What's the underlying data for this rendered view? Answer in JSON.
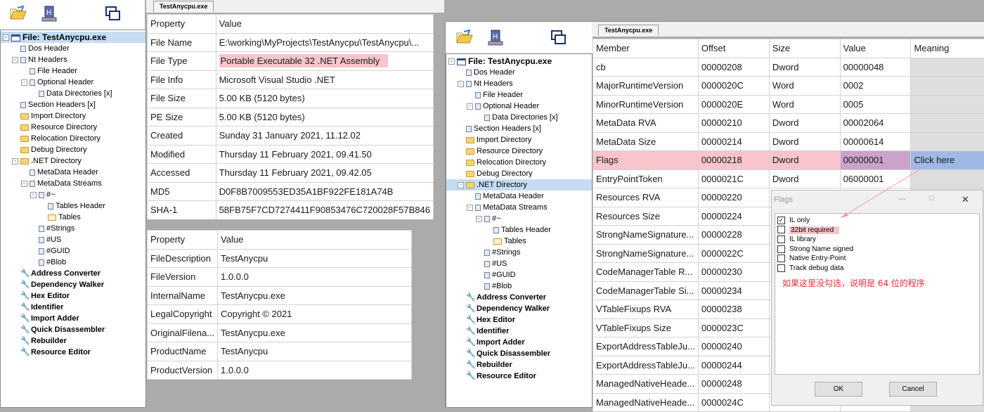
{
  "left_toolbar": {
    "icons": [
      "open-folder-icon",
      "build-icon",
      "windows-icon"
    ]
  },
  "left_tree": {
    "items": [
      {
        "label": "File: TestAnycpu.exe",
        "level": 0,
        "icon": "window",
        "exp": "-",
        "kind": "root",
        "sel": true
      },
      {
        "label": "Dos Header",
        "level": 1,
        "icon": "page"
      },
      {
        "label": "Nt Headers",
        "level": 1,
        "icon": "page",
        "exp": "-"
      },
      {
        "label": "File Header",
        "level": 2,
        "icon": "page"
      },
      {
        "label": "Optional Header",
        "level": 2,
        "icon": "page",
        "exp": "-"
      },
      {
        "label": "Data Directories [x]",
        "level": 3,
        "icon": "page"
      },
      {
        "label": "Section Headers [x]",
        "level": 1,
        "icon": "page"
      },
      {
        "label": "Import Directory",
        "level": 1,
        "icon": "folder"
      },
      {
        "label": "Resource Directory",
        "level": 1,
        "icon": "folder"
      },
      {
        "label": "Relocation Directory",
        "level": 1,
        "icon": "folder"
      },
      {
        "label": "Debug Directory",
        "level": 1,
        "icon": "folder"
      },
      {
        "label": ".NET Directory",
        "level": 1,
        "icon": "folder",
        "exp": "-"
      },
      {
        "label": "MetaData Header",
        "level": 2,
        "icon": "page"
      },
      {
        "label": "MetaData Streams",
        "level": 2,
        "icon": "page",
        "exp": "-"
      },
      {
        "label": "#~",
        "level": 3,
        "icon": "page",
        "exp": "-"
      },
      {
        "label": "Tables Header",
        "level": 4,
        "icon": "page"
      },
      {
        "label": "Tables",
        "level": 4,
        "icon": "folder-open"
      },
      {
        "label": "#Strings",
        "level": 3,
        "icon": "page"
      },
      {
        "label": "#US",
        "level": 3,
        "icon": "page"
      },
      {
        "label": "#GUID",
        "level": 3,
        "icon": "page"
      },
      {
        "label": "#Blob",
        "level": 3,
        "icon": "page"
      },
      {
        "label": "Address Converter",
        "level": 1,
        "icon": "tool",
        "kind": "bold"
      },
      {
        "label": "Dependency Walker",
        "level": 1,
        "icon": "tool",
        "kind": "bold"
      },
      {
        "label": "Hex Editor",
        "level": 1,
        "icon": "tool",
        "kind": "bold"
      },
      {
        "label": "Identifier",
        "level": 1,
        "icon": "tool",
        "kind": "bold"
      },
      {
        "label": "Import Adder",
        "level": 1,
        "icon": "tool",
        "kind": "bold"
      },
      {
        "label": "Quick Disassembler",
        "level": 1,
        "icon": "tool",
        "kind": "bold"
      },
      {
        "label": "Rebuilder",
        "level": 1,
        "icon": "tool",
        "kind": "bold"
      },
      {
        "label": "Resource Editor",
        "level": 1,
        "icon": "tool",
        "kind": "bold"
      }
    ]
  },
  "left_tab": {
    "label": "TestAnycpu.exe"
  },
  "file_info_table": {
    "headers": [
      "Property",
      "Value"
    ],
    "rows": [
      [
        "File Name",
        "E:\\working\\MyProjects\\TestAnycpu\\TestAnycpu\\..."
      ],
      [
        "File Type",
        "Portable Executable 32 .NET Assembly"
      ],
      [
        "File Info",
        "Microsoft Visual Studio .NET"
      ],
      [
        "File Size",
        "5.00 KB (5120 bytes)"
      ],
      [
        "PE Size",
        "5.00 KB (5120 bytes)"
      ],
      [
        "Created",
        "Sunday 31 January 2021, 11.12.02"
      ],
      [
        "Modified",
        "Thursday 11 February 2021, 09.41.50"
      ],
      [
        "Accessed",
        "Thursday 11 February 2021, 09.42.05"
      ],
      [
        "MD5",
        "D0F8B7009553ED35A1BF922FE181A74B"
      ],
      [
        "SHA-1",
        "58FB75F7CD7274411F90853476C720028F57B846"
      ]
    ]
  },
  "version_table": {
    "headers": [
      "Property",
      "Value"
    ],
    "rows": [
      [
        "FileDescription",
        "TestAnycpu"
      ],
      [
        "FileVersion",
        "1.0.0.0"
      ],
      [
        "InternalName",
        "TestAnycpu.exe"
      ],
      [
        "LegalCopyright",
        "Copyright ©  2021"
      ],
      [
        "OriginalFilena...",
        "TestAnycpu.exe"
      ],
      [
        "ProductName",
        "TestAnycpu"
      ],
      [
        "ProductVersion",
        "1.0.0.0"
      ]
    ]
  },
  "right_tab": {
    "label": "TestAnycpu.exe"
  },
  "clr_table": {
    "headers": [
      "Member",
      "Offset",
      "Size",
      "Value",
      "Meaning"
    ],
    "rows": [
      [
        "cb",
        "00000208",
        "Dword",
        "00000048",
        ""
      ],
      [
        "MajorRuntimeVersion",
        "0000020C",
        "Word",
        "0002",
        ""
      ],
      [
        "MinorRuntimeVersion",
        "0000020E",
        "Word",
        "0005",
        ""
      ],
      [
        "MetaData RVA",
        "00000210",
        "Dword",
        "00002064",
        ""
      ],
      [
        "MetaData Size",
        "00000214",
        "Dword",
        "00000614",
        ""
      ],
      [
        "Flags",
        "00000218",
        "Dword",
        "00000001",
        "Click here"
      ],
      [
        "EntryPointToken",
        "0000021C",
        "Dword",
        "06000001",
        ""
      ],
      [
        "Resources RVA",
        "00000220",
        "",
        "",
        ""
      ],
      [
        "Resources Size",
        "00000224",
        "",
        "",
        ""
      ],
      [
        "StrongNameSignature...",
        "00000228",
        "",
        "",
        ""
      ],
      [
        "StrongNameSignature...",
        "0000022C",
        "",
        "",
        ""
      ],
      [
        "CodeManagerTable R...",
        "00000230",
        "",
        "",
        ""
      ],
      [
        "CodeManagerTable Si...",
        "00000234",
        "",
        "",
        ""
      ],
      [
        "VTableFixups RVA",
        "00000238",
        "",
        "",
        ""
      ],
      [
        "VTableFixups Size",
        "0000023C",
        "",
        "",
        ""
      ],
      [
        "ExportAddressTableJu...",
        "00000240",
        "",
        "",
        ""
      ],
      [
        "ExportAddressTableJu...",
        "00000244",
        "",
        "",
        ""
      ],
      [
        "ManagedNativeHeade...",
        "00000248",
        "",
        "",
        ""
      ],
      [
        "ManagedNativeHeade...",
        "0000024C",
        "",
        "",
        ""
      ]
    ]
  },
  "flags_dialog": {
    "title": "Flags",
    "options": [
      {
        "label": "IL only",
        "checked": true
      },
      {
        "label": "32bit required",
        "checked": false
      },
      {
        "label": "IL library",
        "checked": false
      },
      {
        "label": "Strong Name signed",
        "checked": false
      },
      {
        "label": "Native Entry-Point",
        "checked": false
      },
      {
        "label": "Track debug data",
        "checked": false
      }
    ],
    "note": "如果这里没勾选，说明是 64 位的程序",
    "ok_label": "OK",
    "cancel_label": "Cancel",
    "check_mark": "✓",
    "minimize_glyph": "—",
    "maximize_glyph": "□",
    "close_glyph": "✕"
  },
  "colors": {
    "highlight_red": "#f7c5cb",
    "highlight_purple": "#c9a3c8",
    "highlight_blue": "#9fb8e4",
    "note_red": "#e8303a",
    "selection": "#c5dcf2"
  }
}
